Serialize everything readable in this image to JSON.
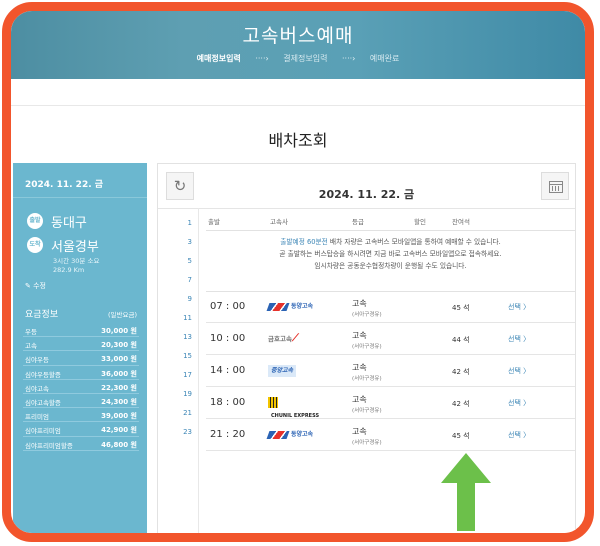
{
  "header": {
    "title": "고속버스예매",
    "steps": [
      "예매정보입력",
      "결제정보입력",
      "예매완료"
    ],
    "arrow": "····›"
  },
  "page_title": "배차조회",
  "left": {
    "date": "2024. 11. 22. 금",
    "departure_badge": "출발",
    "departure": "동대구",
    "arrival_badge": "도착",
    "arrival": "서울경부",
    "duration": "3시간 30분 소요",
    "distance": "282.9 Km",
    "modify": "수정",
    "fare_title": "요금정보",
    "fare_note": "(일반요금)",
    "fares": [
      {
        "name": "우등",
        "price": "30,000 원"
      },
      {
        "name": "고속",
        "price": "20,300 원"
      },
      {
        "name": "심야우등",
        "price": "33,000 원"
      },
      {
        "name": "심야우등할증",
        "price": "36,000 원"
      },
      {
        "name": "심야고속",
        "price": "22,300 원"
      },
      {
        "name": "심야고속할증",
        "price": "24,300 원"
      },
      {
        "name": "프리미엄",
        "price": "39,000 원"
      },
      {
        "name": "심야프리미엄",
        "price": "42,900 원"
      },
      {
        "name": "심야프리미엄할증",
        "price": "46,800 원"
      }
    ]
  },
  "grid": {
    "date": "2024. 11. 22. 금",
    "hours": [
      "1",
      "3",
      "5",
      "7",
      "9",
      "11",
      "13",
      "15",
      "17",
      "19",
      "21",
      "23"
    ],
    "columns": [
      "출발",
      "고속사",
      "등급",
      "할인",
      "잔여석"
    ],
    "notice": {
      "l1_hl": "출발예정 60분전",
      "l1_rest": " 배차 자량은 고속버스 모바일앱을 통하여 예매할 수 있습니다.",
      "l2": "곧 출발하는 버스탑승을 하시려면 지금 바로 고속버스 모바일앱으로 접속하세요.",
      "l3": "임시차량은 공동운수협정차량이 운행될 수도 있습니다."
    },
    "rows": [
      {
        "time": "07 : 00",
        "company": "동양고속",
        "grade": "고속",
        "route": "(서아구경유)",
        "seats": "45 석",
        "select": "선택 〉"
      },
      {
        "time": "10 : 00",
        "company": "금호고속",
        "grade": "고속",
        "route": "(서아구경유)",
        "seats": "44 석",
        "select": "선택 〉"
      },
      {
        "time": "14 : 00",
        "company": "중앙고속",
        "grade": "고속",
        "route": "(서아구경유)",
        "seats": "42 석",
        "select": "선택 〉"
      },
      {
        "time": "18 : 00",
        "company": "CHUNIL EXPRESS",
        "grade": "고속",
        "route": "(서아구경유)",
        "seats": "42 석",
        "select": "선택 〉"
      },
      {
        "time": "21 : 20",
        "company": "동양고속",
        "grade": "고속",
        "route": "(서아구경유)",
        "seats": "45 석",
        "select": "선택 〉"
      }
    ]
  },
  "colors": {
    "frame": "#f2552c",
    "panel": "#6bb7cf",
    "link": "#3c86b6",
    "arrow": "#6cc04a"
  }
}
